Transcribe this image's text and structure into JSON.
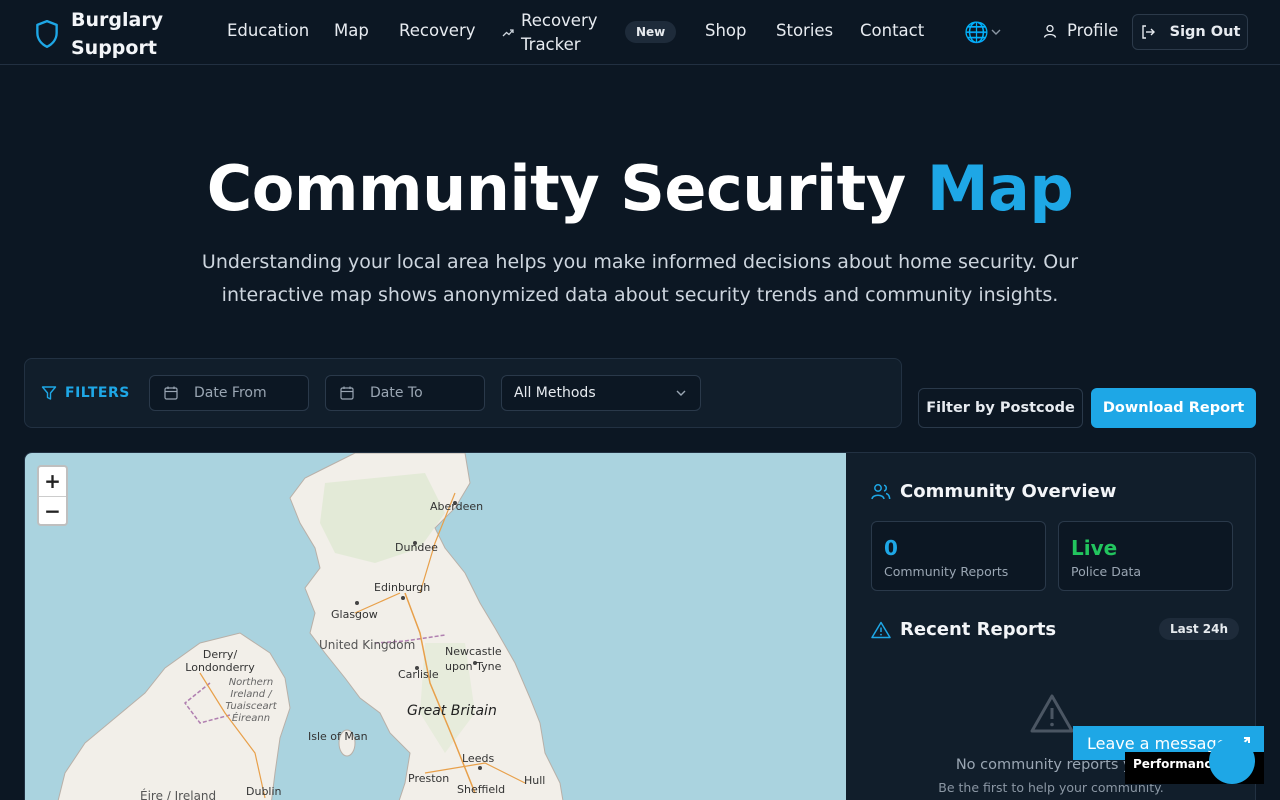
{
  "brand": {
    "name": "Burglary Support",
    "icon": "shield-icon"
  },
  "nav": {
    "education": "Education",
    "map": "Map",
    "recovery": "Recovery",
    "tracker": "Recovery Tracker",
    "tracker_badge": "New",
    "shop": "Shop",
    "stories": "Stories",
    "contact": "Contact",
    "language_icon": "globe-icon",
    "profile": "Profile",
    "sign_out": "Sign Out"
  },
  "hero": {
    "title_main": "Community Security",
    "title_accent": "Map",
    "subtitle": "Understanding your local area helps you make informed decisions about home security. Our interactive map shows anonymized data about security trends and community insights."
  },
  "filters": {
    "label": "FILTERS",
    "date_from_placeholder": "Date From",
    "date_to_placeholder": "Date To",
    "method_selected": "All Methods",
    "postcode_button": "Filter by Postcode",
    "download_button": "Download Report"
  },
  "map": {
    "zoom_in": "+",
    "zoom_out": "−",
    "labels": {
      "aberdeen": "Aberdeen",
      "dundee": "Dundee",
      "edinburgh": "Edinburgh",
      "glasgow": "Glasgow",
      "united_kingdom": "United Kingdom",
      "newcastle": "Newcastle upon Tyne",
      "derry": "Derry/ Londonderry",
      "northern_ireland": "Northern Ireland / Tuaisceart Éireann",
      "carlisle": "Carlisle",
      "great_britain": "Great Britain",
      "isle_of_man": "Isle of Man",
      "leeds": "Leeds",
      "preston": "Preston",
      "hull": "Hull",
      "eire": "Éire / Ireland",
      "dublin": "Dublin",
      "sheffield": "Sheffield"
    }
  },
  "panel": {
    "overview_title": "Community Overview",
    "stats": [
      {
        "value": "0",
        "label": "Community Reports",
        "color": "#1ea7e6"
      },
      {
        "value": "Live",
        "label": "Police Data",
        "color": "#22c55e"
      }
    ],
    "recent_title": "Recent Reports",
    "recent_badge": "Last 24h",
    "empty_text": "No community reports yet",
    "empty_sub": "Be the first to help your community."
  },
  "widgets": {
    "chat": "Leave a message",
    "performance": "Performance"
  },
  "colors": {
    "accent": "#1ea7e6",
    "background": "#0c1723",
    "live": "#22c55e"
  }
}
